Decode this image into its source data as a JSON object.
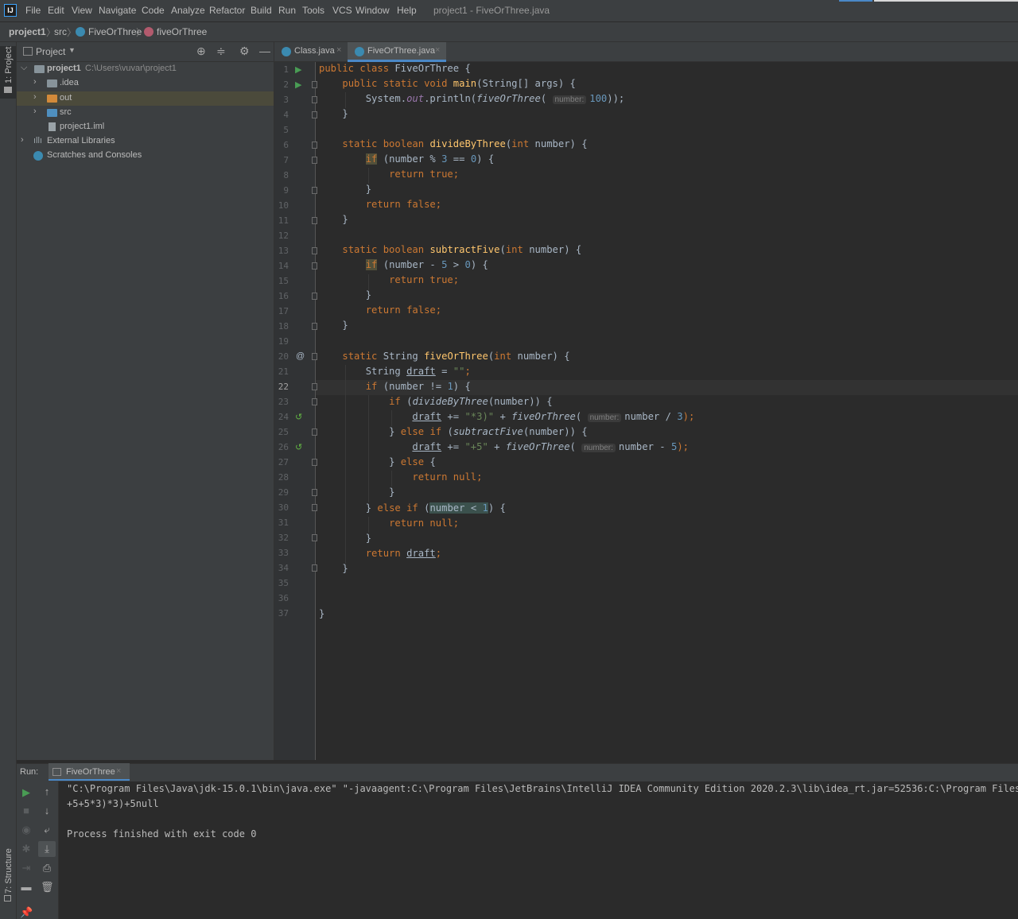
{
  "menu": {
    "items": [
      "File",
      "Edit",
      "View",
      "Navigate",
      "Code",
      "Analyze",
      "Refactor",
      "Build",
      "Run",
      "Tools",
      "VCS",
      "Window",
      "Help"
    ],
    "window_title": "project1 - FiveOrThree.java"
  },
  "breadcrumb": {
    "project": "project1",
    "src": "src",
    "class": "FiveOrThree",
    "method": "fiveOrThree"
  },
  "left_strip": {
    "project": "1: Project",
    "structure": "7: Structure"
  },
  "project_panel": {
    "title": "Project",
    "tree": [
      {
        "label": "project1",
        "path": "C:\\Users\\vuvar\\project1"
      },
      {
        "label": ".idea"
      },
      {
        "label": "out"
      },
      {
        "label": "src"
      },
      {
        "label": "project1.iml"
      },
      {
        "label": "External Libraries"
      },
      {
        "label": "Scratches and Consoles"
      }
    ]
  },
  "tabs": [
    {
      "label": "Class.java"
    },
    {
      "label": "FiveOrThree.java"
    }
  ],
  "editor": {
    "current_line": 22,
    "line_numbers": [
      "1",
      "2",
      "3",
      "4",
      "5",
      "6",
      "7",
      "8",
      "9",
      "10",
      "11",
      "12",
      "13",
      "14",
      "15",
      "16",
      "17",
      "18",
      "19",
      "20",
      "21",
      "22",
      "23",
      "24",
      "25",
      "26",
      "27",
      "28",
      "29",
      "30",
      "31",
      "32",
      "33",
      "34",
      "35",
      "36",
      "37"
    ],
    "hint_label": "number:",
    "tokens": {
      "l1_public": "public",
      "l1_class": "class",
      "l1_name": " FiveOrThree {",
      "l2_mods": "public static void",
      "l2_main": "main",
      "l2_args": "(String[] args) {",
      "l3_sys": "System.",
      "l3_out": "out",
      "l3_println": ".println(",
      "l3_call": "fiveOrThree",
      "l3_open": "(",
      "l3_num": "100",
      "l3_close": "));",
      "brace_close": "}",
      "l6_mods": "static boolean",
      "l6_fn": "divideByThree",
      "l6_open": "(",
      "l6_int": "int",
      "l6_rest": " number) {",
      "if_kw": "if",
      "l7_a": " (number % ",
      "l7_n3": "3",
      "l7_b": " == ",
      "l7_n0": "0",
      "l7_c": ") {",
      "return_true": "return true;",
      "return_false": "return false;",
      "l13_mods": "static boolean",
      "l13_fn": "subtractFive",
      "l13_open": "(",
      "l13_int": "int",
      "l13_rest": " number) {",
      "l14_a": " (number - ",
      "l14_n5": "5",
      "l14_b": " > ",
      "l14_n0": "0",
      "l14_c": ") {",
      "l20_static": "static",
      "l20_type": " String ",
      "l20_fn": "fiveOrThree",
      "l20_open": "(",
      "l20_int": "int",
      "l20_rest": " number) {",
      "l21_type": "String ",
      "draft": "draft",
      "l21_eq": " = ",
      "l21_str": "\"\"",
      "l21_semi": ";",
      "l22_a": " (number != ",
      "l22_n1": "1",
      "l22_b": ") {",
      "l23_a": " (",
      "l23_fn": "divideByThree",
      "l23_b": "(number)) {",
      "l24_op": " += ",
      "l24_str": "\"*3)\"",
      "l24_plus": " + ",
      "l24_fn": "fiveOrThree",
      "l24_open": "(",
      "l24_arg": "number / ",
      "l24_n3": "3",
      "l24_close": ");",
      "l25_close": "} ",
      "else_kw": "else",
      "l25_if": " if",
      "l25_a": " (",
      "l25_fn": "subtractFive",
      "l25_b": "(number)) {",
      "l26_str": "\"+5\"",
      "l26_arg": "number - ",
      "l26_n5": "5",
      "l27_open": " {",
      "return_null": "return null;",
      "l30_cond": "number < ",
      "l30_n1": "1",
      "l30_end": ") {",
      "return_kw": "return ",
      "semi": ";"
    }
  },
  "run_panel": {
    "label": "Run:",
    "tab": "FiveOrThree",
    "output": [
      "\"C:\\Program Files\\Java\\jdk-15.0.1\\bin\\java.exe\" \"-javaagent:C:\\Program Files\\JetBrains\\IntelliJ IDEA Community Edition 2020.2.3\\lib\\idea_rt.jar=52536:C:\\Program Files",
      "+5+5*3)*3)+5null",
      "",
      "Process finished with exit code 0"
    ]
  },
  "colors": {
    "accent": "#4a88c7",
    "keyword": "#cc7832",
    "function": "#ffc66d",
    "number": "#6897bb",
    "string": "#6a8759",
    "static_field": "#9876aa",
    "selection_row": "#4b4a3b"
  },
  "icons": [
    "idea-logo",
    "folder-icon",
    "class-icon",
    "method-icon",
    "run-gutter-icon",
    "override-icon",
    "recursion-icon",
    "locate-icon",
    "collapse-icon",
    "gear-icon",
    "minimize-icon",
    "rerun-icon",
    "stop-icon",
    "scroll-up-icon",
    "scroll-down-icon",
    "soft-wrap-icon",
    "print-icon",
    "trash-icon",
    "pin-icon"
  ]
}
